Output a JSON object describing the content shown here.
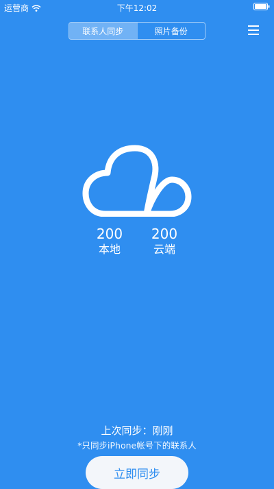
{
  "status_bar": {
    "carrier": "运营商",
    "time": "下午12:02"
  },
  "tabs": [
    {
      "label": "联系人同步",
      "active": true
    },
    {
      "label": "照片备份",
      "active": false
    }
  ],
  "icons": {
    "menu": "menu-icon",
    "cloud": "cloud-icon",
    "wifi": "wifi-icon",
    "battery": "battery-icon"
  },
  "counts": {
    "local": {
      "value": "200",
      "label": "本地"
    },
    "cloud": {
      "value": "200",
      "label": "云端"
    }
  },
  "sync_info": {
    "last_sync": "上次同步：刚刚",
    "note": "*只同步iPhone帐号下的联系人"
  },
  "actions": {
    "sync_now": "立即同步"
  },
  "colors": {
    "background": "#2f8ef0",
    "button_bg": "#f3f6fa",
    "button_text": "#2f8ef0"
  }
}
